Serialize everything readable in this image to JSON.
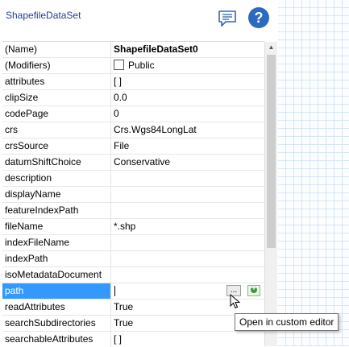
{
  "header": {
    "title": "ShapefileDataSet"
  },
  "properties": [
    {
      "name": "(Name)",
      "value": "ShapefileDataSet0"
    },
    {
      "name": "(Modifiers)",
      "value": "Public"
    },
    {
      "name": "attributes",
      "value": "[ ]"
    },
    {
      "name": "clipSize",
      "value": "0.0"
    },
    {
      "name": "codePage",
      "value": "0"
    },
    {
      "name": "crs",
      "value": "Crs.Wgs84LongLat"
    },
    {
      "name": "crsSource",
      "value": "File"
    },
    {
      "name": "datumShiftChoice",
      "value": "Conservative"
    },
    {
      "name": "description",
      "value": ""
    },
    {
      "name": "displayName",
      "value": ""
    },
    {
      "name": "featureIndexPath",
      "value": ""
    },
    {
      "name": "fileName",
      "value": "*.shp"
    },
    {
      "name": "indexFileName",
      "value": ""
    },
    {
      "name": "indexPath",
      "value": ""
    },
    {
      "name": "isoMetadataDocument",
      "value": ""
    },
    {
      "name": "path",
      "value": ""
    },
    {
      "name": "readAttributes",
      "value": "True"
    },
    {
      "name": "searchSubdirectories",
      "value": "True"
    },
    {
      "name": "searchableAttributes",
      "value": "[ ]"
    }
  ],
  "path_row": {
    "ellipsis_label": "..."
  },
  "tooltip": {
    "text": "Open in custom editor"
  },
  "colors": {
    "selection": "#3399ff",
    "header_title": "#1f3f8f",
    "help_button": "#2c6ac0",
    "add_button": "#3a9a3a",
    "canvas_grid": "#d8e6f6"
  },
  "icons": {
    "comment": "comment-icon",
    "help": "help-icon",
    "add": "add-icon",
    "cursor": "mouse-pointer-icon"
  }
}
